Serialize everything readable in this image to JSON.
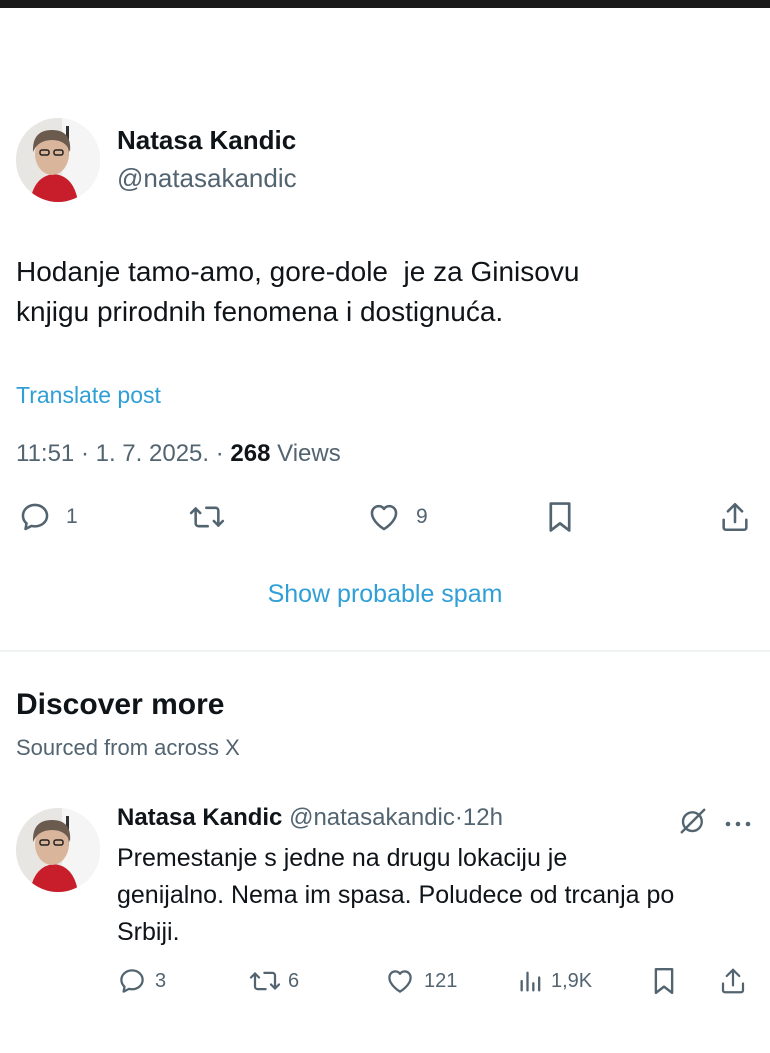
{
  "post": {
    "author_name": "Natasa Kandic",
    "author_handle": "@natasakandic",
    "text_line1": "Hodanje tamo-amo, gore-dole  je za Ginisovu",
    "text_line2": "knjigu prirodnih fenomena i dostignuća.",
    "translate_label": "Translate post",
    "time": "11:51",
    "date": "1. 7. 2025.",
    "separator": "·",
    "views_count": "268",
    "views_label": "Views",
    "actions": {
      "reply_count": "1",
      "repost_count": "",
      "like_count": "9"
    },
    "icons": [
      "reply-icon",
      "repost-icon",
      "like-icon",
      "bookmark-icon",
      "share-icon"
    ]
  },
  "spam_link": "Show probable spam",
  "discover": {
    "title": "Discover more",
    "subtitle": "Sourced from across X"
  },
  "reply_post": {
    "author_name": "Natasa Kandic",
    "author_handle": "@natasakandic",
    "separator": "·",
    "time": "12h",
    "text_line1": "Premestanje s jedne na drugu lokaciju je",
    "text_line2": "genijalno. Nema im spasa. Poludece od trcanja po",
    "text_line3": "Srbiji.",
    "actions": {
      "reply_count": "3",
      "repost_count": "6",
      "like_count": "121",
      "views_count": "1,9K"
    },
    "icons": [
      "grok-icon",
      "more-icon",
      "reply-icon",
      "repost-icon",
      "like-icon",
      "analytics-icon",
      "bookmark-icon",
      "share-icon"
    ]
  },
  "colors": {
    "text": "#0f1419",
    "secondary": "#536471",
    "link": "#2f9fd6",
    "divider": "#eff3f4"
  }
}
